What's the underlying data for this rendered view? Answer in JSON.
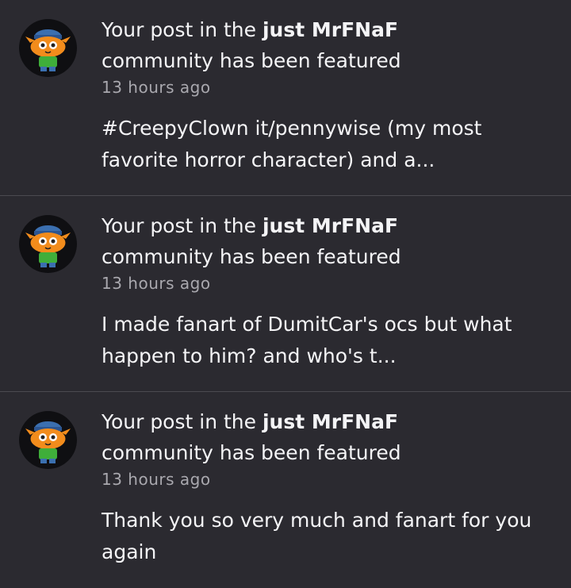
{
  "notifications": [
    {
      "line1_prefix": "Your post in the ",
      "community": "just MrFNaF",
      "line2": "community has been featured",
      "time": "13 hours ago",
      "preview_line1": "#CreepyClown it/pennywise (my most",
      "preview_line2": "favorite horror character) and a..."
    },
    {
      "line1_prefix": "Your post in the ",
      "community": "just MrFNaF",
      "line2": "community has been featured",
      "time": "13 hours ago",
      "preview_line1": "I made fanart of DumitCar's ocs but what",
      "preview_line2": "happen to him? and who's t..."
    },
    {
      "line1_prefix": "Your post in the ",
      "community": "just MrFNaF",
      "line2": "community has been featured",
      "time": "13 hours ago",
      "preview_line1": "Thank you so very much and fanart for you",
      "preview_line2": "again"
    }
  ],
  "colors": {
    "background": "#2b2a30",
    "divider": "#4b4a50",
    "text": "#f4f4f6",
    "muted": "#a9a8ae",
    "avatar_orange": "#f28c1c",
    "avatar_hat": "#3b6fb0",
    "avatar_shirt": "#3fae3a"
  },
  "icons": {
    "avatar": "orange-cat-avatar-icon"
  }
}
